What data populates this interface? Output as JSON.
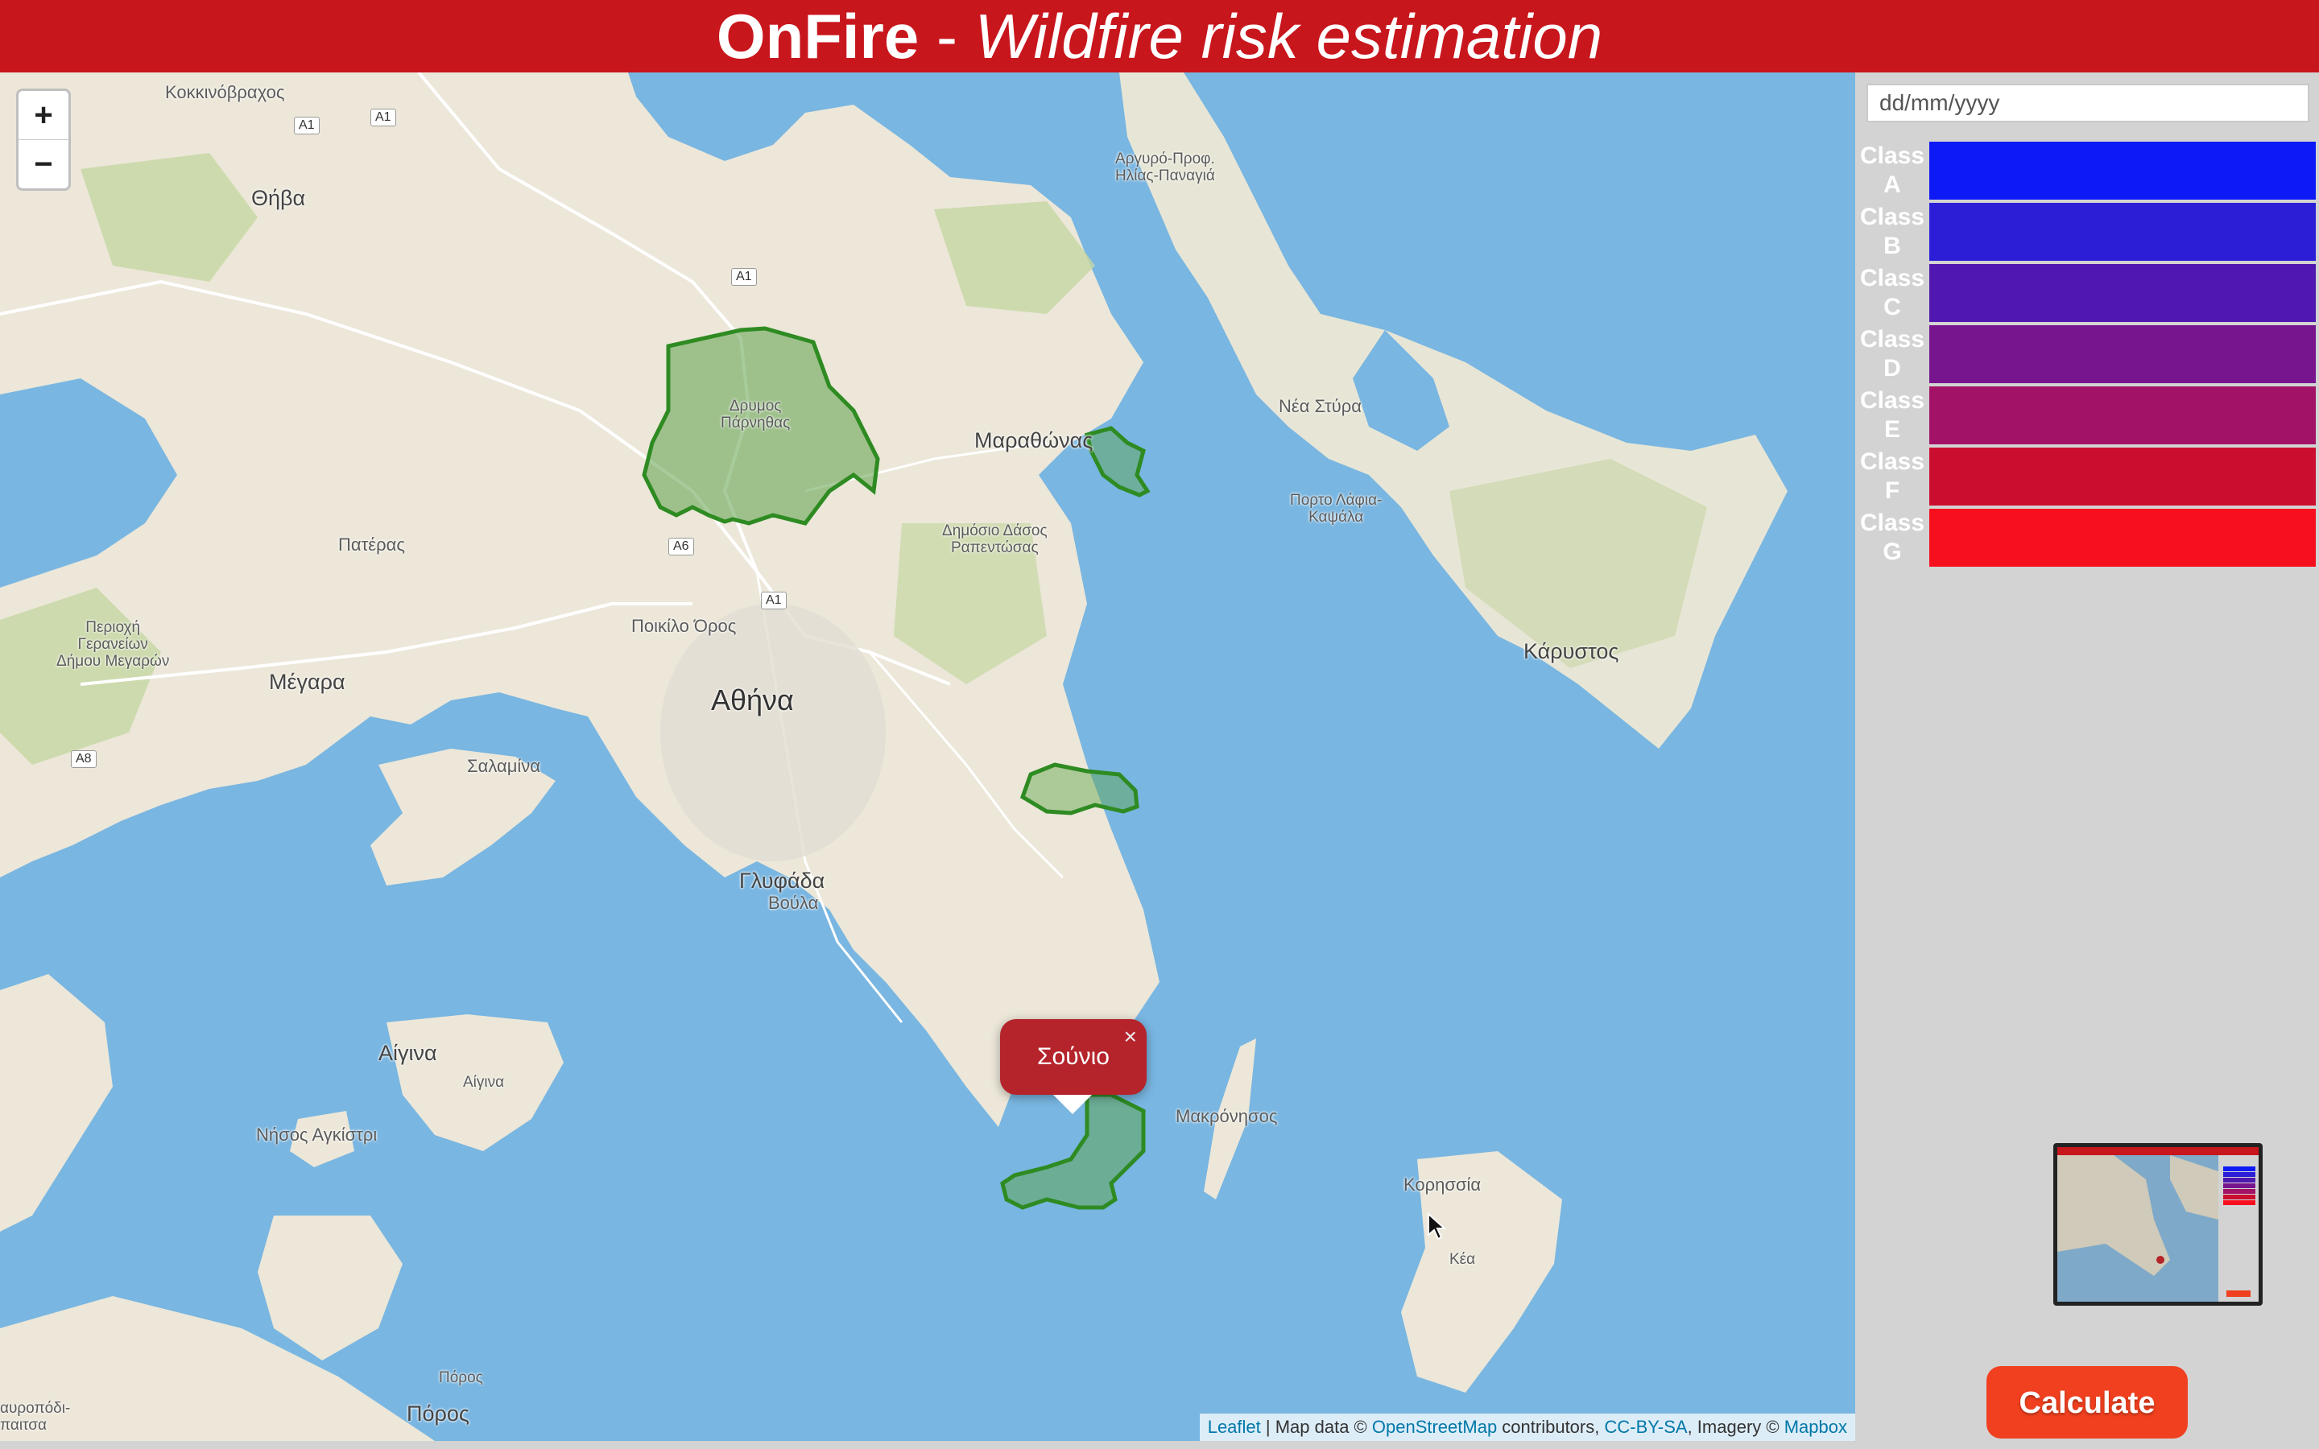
{
  "header": {
    "brand": "OnFire",
    "separator": " - ",
    "subtitle": "Wildfire risk estimation"
  },
  "map": {
    "zoom_in": "+",
    "zoom_out": "−",
    "places": {
      "kokkinovrachos": "Κοκκινόβραχος",
      "thiva": "Θήβα",
      "argyro": "Αργυρό-Προφ.\nΗλίας-Παναγιά",
      "drymos": "Δρυμος\nΠάρνηθας",
      "marathonas": "Μαραθώνας",
      "nea_styra": "Νέα Στύρα",
      "porto_lafia": "Πορτο Λάφια-\nΚαψάλα",
      "pateras": "Πατέρας",
      "dimosio_dasos": "Δημόσιο Δάσος\nΡαπεντώσας",
      "periochi": "Περιοχή\nΓερανείων\nΔήμου Μεγαρών",
      "poikilo": "Ποικίλο Όρος",
      "karystos": "Κάρυστος",
      "megara": "Μέγαρα",
      "athina": "Αθήνα",
      "salamina": "Σαλαμίνα",
      "glyfada": "Γλυφάδα",
      "voula": "Βούλα",
      "aigina_big": "Αίγινα",
      "aigina_small": "Αίγινα",
      "makronisos": "Μακρόνησος",
      "nisos_agkistri": "Νήσος Αγκίστρι",
      "korissia": "Κορησσία",
      "kea": "Κέα",
      "poros_small": "Πόρος",
      "poros_big": "Πόρος",
      "stavropodi": "αυροπόδι-\nπαιτσα"
    },
    "road_shields": [
      "A1",
      "A1",
      "A1",
      "A6",
      "A1",
      "A8"
    ],
    "popup": {
      "label": "Σούνιο",
      "close": "×"
    },
    "attribution": {
      "leaflet": "Leaflet",
      "sep1": " | Map data © ",
      "osm": "OpenStreetMap",
      "sep2": " contributors, ",
      "license": "CC-BY-SA",
      "sep3": ", Imagery © ",
      "mapbox": "Mapbox"
    },
    "region_color": "#2e8b22"
  },
  "sidebar": {
    "date_placeholder": "dd/mm/yyyy",
    "legend": [
      {
        "label": "Class A",
        "color": "#0d1af5"
      },
      {
        "label": "Class B",
        "color": "#2b1ed6"
      },
      {
        "label": "Class C",
        "color": "#5018b0"
      },
      {
        "label": "Class D",
        "color": "#76158d"
      },
      {
        "label": "Class E",
        "color": "#a21367"
      },
      {
        "label": "Class F",
        "color": "#cb0e30"
      },
      {
        "label": "Class G",
        "color": "#f70f1e"
      }
    ],
    "calculate_label": "Calculate"
  },
  "colors": {
    "header": "#c8161d",
    "sea": "#79b6e1",
    "land": "#ece7d9",
    "popup": "#b5232b",
    "calculate": "#f0401f"
  }
}
